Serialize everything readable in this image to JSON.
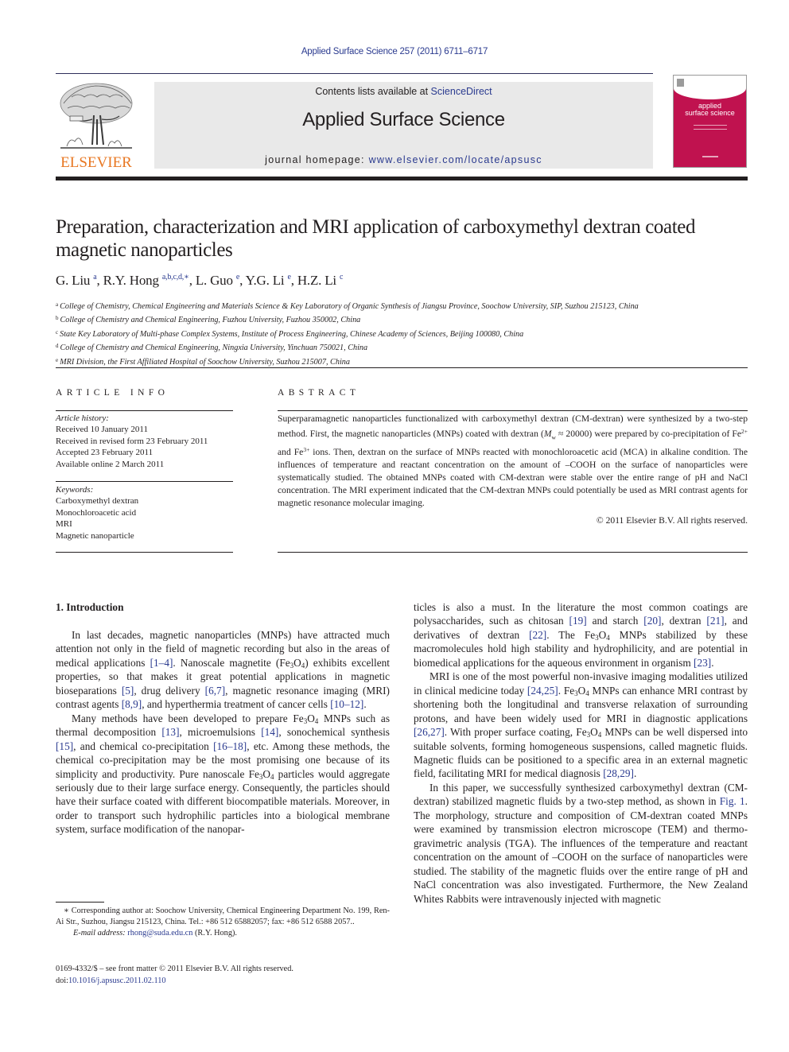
{
  "journal_ref": "Applied Surface Science 257 (2011) 6711–6717",
  "header": {
    "contents_prefix": "Contents lists available at ",
    "contents_link": "ScienceDirect",
    "journal_title": "Applied Surface Science",
    "homepage_prefix": "journal homepage: ",
    "homepage_link": "www.elsevier.com/locate/apsusc",
    "publisher_logo_text": "ELSEVIER",
    "cover_title_line1": "applied",
    "cover_title_line2": "surface science",
    "colors": {
      "publisher_orange": "#e87722",
      "cover_magenta": "#c0124f",
      "link_blue": "#2a3a8f",
      "band_gray": "#e9e9e9"
    }
  },
  "article": {
    "title": "Preparation, characterization and MRI application of carboxymethyl dextran coated magnetic nanoparticles",
    "authors": [
      {
        "name": "G. Liu",
        "sup": "a"
      },
      {
        "name": "R.Y. Hong",
        "sup": "a,b,c,d,∗"
      },
      {
        "name": "L. Guo",
        "sup": "e"
      },
      {
        "name": "Y.G. Li",
        "sup": "e"
      },
      {
        "name": "H.Z. Li",
        "sup": "c"
      }
    ],
    "affiliations": [
      {
        "key": "a",
        "text": "College of Chemistry, Chemical Engineering and Materials Science & Key Laboratory of Organic Synthesis of Jiangsu Province, Soochow University, SIP, Suzhou 215123, China"
      },
      {
        "key": "b",
        "text": "College of Chemistry and Chemical Engineering, Fuzhou University, Fuzhou 350002, China"
      },
      {
        "key": "c",
        "text": "State Key Laboratory of Multi-phase Complex Systems, Institute of Process Engineering, Chinese Academy of Sciences, Beijing 100080, China"
      },
      {
        "key": "d",
        "text": "College of Chemistry and Chemical Engineering, Ningxia University, Yinchuan 750021, China"
      },
      {
        "key": "e",
        "text": "MRI Division, the First Affiliated Hospital of Soochow University, Suzhou 215007, China"
      }
    ]
  },
  "article_info": {
    "heading": "ARTICLE INFO",
    "history_label": "Article history:",
    "history": [
      "Received 10 January 2011",
      "Received in revised form 23 February 2011",
      "Accepted 23 February 2011",
      "Available online 2 March 2011"
    ],
    "keywords_label": "Keywords:",
    "keywords": [
      "Carboxymethyl dextran",
      "Monochloroacetic acid",
      "MRI",
      "Magnetic nanoparticle"
    ]
  },
  "abstract": {
    "heading": "ABSTRACT",
    "part1": "Superparamagnetic nanoparticles functionalized with carboxymethyl dextran (CM-dextran) were synthesized by a two-step method. First, the magnetic nanoparticles (MNPs) coated with dextran (",
    "mw_symbol": "M",
    "mw_sub": "w",
    "part2": " ≈ 20000) were prepared by co-precipitation of Fe",
    "ion1_sup": "2+",
    "part3": " and Fe",
    "ion2_sup": "3+",
    "part4": " ions. Then, dextran on the surface of MNPs reacted with monochloroacetic acid (MCA) in alkaline condition. The influences of temperature and reactant concentration on the amount of –COOH on the surface of nanoparticles were systematically studied. The obtained MNPs coated with CM-dextran were stable over the entire range of pH and NaCl concentration. The MRI experiment indicated that the CM-dextran MNPs could potentially be used as MRI contrast agents for magnetic resonance molecular imaging.",
    "copyright": "© 2011 Elsevier B.V. All rights reserved."
  },
  "body": {
    "section_heading": "1.  Introduction",
    "left_p1": [
      "In last decades, magnetic nanoparticles (MNPs) have attracted much attention not only in the field of magnetic recording but also in the areas of medical applications ",
      "[1–4]",
      ". Nanoscale magnetite (Fe",
      "3",
      "O",
      "4",
      ") exhibits excellent properties, so that makes it great potential applications in magnetic bioseparations ",
      "[5]",
      ", drug delivery ",
      "[6,7]",
      ", magnetic resonance imaging (MRI) contrast agents ",
      "[8,9]",
      ", and hyperthermia treatment of cancer cells ",
      "[10–12]",
      "."
    ],
    "left_p2": [
      "Many methods have been developed to prepare Fe",
      "3",
      "O",
      "4",
      " MNPs such as thermal decomposition ",
      "[13]",
      ", microemulsions ",
      "[14]",
      ", sonochemical synthesis ",
      "[15]",
      ", and chemical co-precipitation ",
      "[16–18]",
      ", etc. Among these methods, the chemical co-precipitation may be the most promising one because of its simplicity and productivity. Pure nanoscale Fe",
      "3",
      "O",
      "4",
      " particles would aggregate seriously due to their large surface energy. Consequently, the particles should have their surface coated with different biocompatible materials. Moreover, in order to transport such hydrophilic particles into a biological membrane system, surface modification of the nanopar-"
    ],
    "right_p1": [
      "ticles is also a must. In the literature the most common coatings are polysaccharides, such as chitosan ",
      "[19]",
      " and starch ",
      "[20]",
      ", dextran ",
      "[21]",
      ", and derivatives of dextran ",
      "[22]",
      ". The Fe",
      "3",
      "O",
      "4",
      " MNPs stabilized by these macromolecules hold high stability and hydrophilicity, and are potential in biomedical applications for the aqueous environment in organism ",
      "[23]",
      "."
    ],
    "right_p2": [
      "MRI is one of the most powerful non-invasive imaging modalities utilized in clinical medicine today ",
      "[24,25]",
      ". Fe",
      "3",
      "O",
      "4",
      " MNPs can enhance MRI contrast by shortening both the longitudinal and transverse relaxation of surrounding protons, and have been widely used for MRI in diagnostic applications ",
      "[26,27]",
      ". With proper surface coating, Fe",
      "3",
      "O",
      "4",
      " MNPs can be well dispersed into suitable solvents, forming homogeneous suspensions, called magnetic fluids. Magnetic fluids can be positioned to a specific area in an external magnetic field, facilitating MRI for medical diagnosis ",
      "[28,29]",
      "."
    ],
    "right_p3": [
      "In this paper, we successfully synthesized carboxymethyl dextran (CM-dextran) stabilized magnetic fluids by a two-step method, as shown in ",
      "Fig. 1",
      ". The morphology, structure and composition of CM-dextran coated MNPs were examined by transmission electron microscope (TEM) and thermo-gravimetric analysis (TGA). The influences of the temperature and reactant concentration on the amount of –COOH on the surface of nanoparticles were studied. The stability of the magnetic fluids over the entire range of pH and NaCl concentration was also investigated. Furthermore, the New Zealand Whites Rabbits were intravenously injected with magnetic"
    ]
  },
  "footnotes": {
    "corresponding": "∗ Corresponding author at: Soochow University, Chemical Engineering Department No. 199, Ren-Ai Str., Suzhou, Jiangsu 215123, China. Tel.: +86 512 65882057; fax: +86 512 6588 2057..",
    "email_label": "E-mail address: ",
    "email": "rhong@suda.edu.cn",
    "email_suffix": " (R.Y. Hong).",
    "front_matter": "0169-4332/$ – see front matter © 2011 Elsevier B.V. All rights reserved.",
    "doi_prefix": "doi:",
    "doi": "10.1016/j.apsusc.2011.02.110"
  }
}
